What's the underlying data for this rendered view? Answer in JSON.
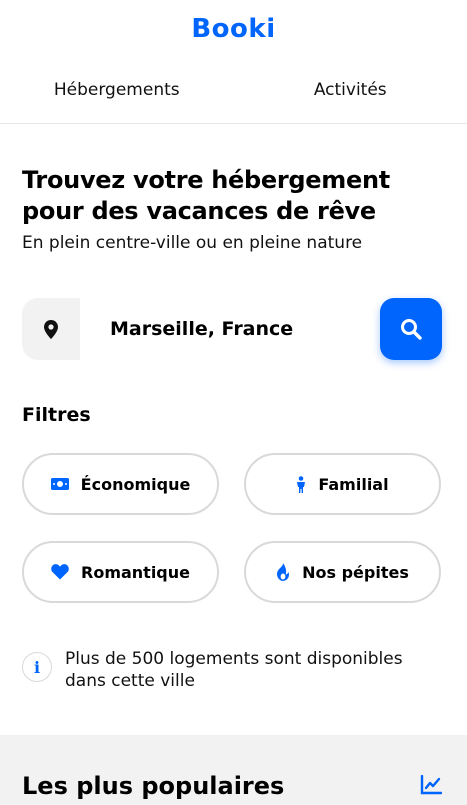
{
  "header": {
    "logo_part1": "Bo",
    "logo_part2": "o",
    "logo_part3": "ki",
    "nav": [
      {
        "label": "Hébergements"
      },
      {
        "label": "Activités"
      }
    ]
  },
  "hero": {
    "title": "Trouvez votre hébergement pour des vacances de rêve",
    "subtitle": "En plein centre-ville ou en pleine nature"
  },
  "search": {
    "value": "Marseille, France",
    "location_icon": "map-pin-icon",
    "button_icon": "search-icon"
  },
  "filters": {
    "title": "Filtres",
    "items": [
      {
        "label": "Économique",
        "icon": "money-bill-icon"
      },
      {
        "label": "Familial",
        "icon": "child-icon"
      },
      {
        "label": "Romantique",
        "icon": "heart-icon"
      },
      {
        "label": "Nos pépites",
        "icon": "fire-icon"
      }
    ]
  },
  "info": {
    "icon": "info-icon",
    "icon_glyph": "i",
    "text": "Plus de 500 logements sont disponibles dans cette ville"
  },
  "popular": {
    "title": "Les plus populaires",
    "icon": "chart-line-icon"
  },
  "colors": {
    "accent": "#0065fc",
    "section_bg": "#f2f2f2",
    "chip_border": "#d9d9d9"
  }
}
